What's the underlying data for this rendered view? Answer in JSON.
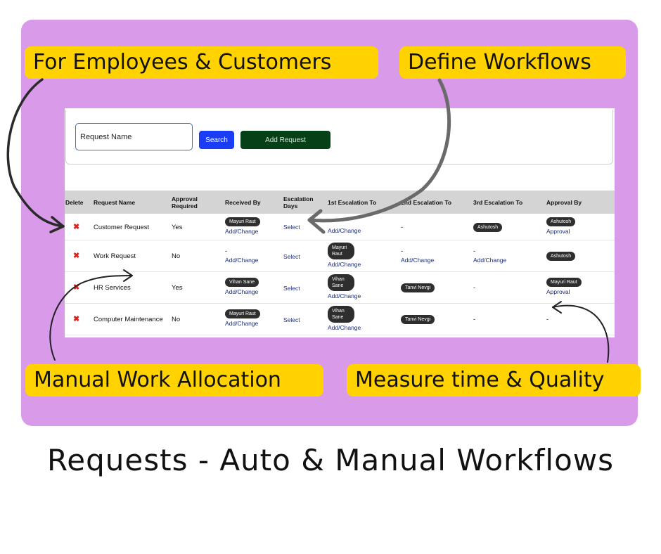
{
  "callouts": {
    "employees": "For Employees & Customers",
    "workflows": "Define Workflows",
    "manual": "Manual Work Allocation",
    "measure": "Measure time & Quality"
  },
  "footer_title": "Requests - Auto & Manual Workflows",
  "search": {
    "value": "Request Name",
    "search_label": "Search",
    "add_label": "Add Request"
  },
  "table": {
    "headers": {
      "delete": "Delete",
      "name": "Request Name",
      "approval": "Approval Required",
      "received": "Received By",
      "days": "Escalation Days",
      "esc1": "1st Escalation To",
      "esc2": "2nd Escalation To",
      "esc3": "3rd Escalation To",
      "approver": "Approval By"
    },
    "add_change": "Add/Change",
    "select": "Select",
    "approval_link": "Approval",
    "dash": "-",
    "rows": [
      {
        "name": "Customer Request",
        "approval": "Yes",
        "received_chip": "Mayuri Raut",
        "esc2": "-",
        "esc3_chip": "Ashutosh",
        "approver_chip": "Ashutosh"
      },
      {
        "name": "Work Request",
        "approval": "No",
        "esc1_chip": "Mayuri Raut",
        "esc2": "-",
        "esc3": "-",
        "approver_chip": "Ashutosh"
      },
      {
        "name": "HR Services",
        "approval": "Yes",
        "received_chip": "Vihan Sane",
        "esc1_chip": "Vihan Sane",
        "esc2_chip": "Tanvi Nevgi",
        "esc3": "-",
        "approver_chip": "Mayuri Raut"
      },
      {
        "name": "Computer Maintenance",
        "approval": "No",
        "received_chip": "Mayuri Raut",
        "esc1_chip": "Vihan Sane",
        "esc2_chip": "Tanvi Nevgi",
        "esc3": "-",
        "approver": "-"
      }
    ]
  },
  "colors": {
    "panel": "#d89ae9",
    "callout": "#ffd200",
    "search_button": "#1a3df5",
    "add_button": "#054016",
    "delete_mark": "#e0201b"
  },
  "icons": {
    "delete": "close-x-icon"
  }
}
